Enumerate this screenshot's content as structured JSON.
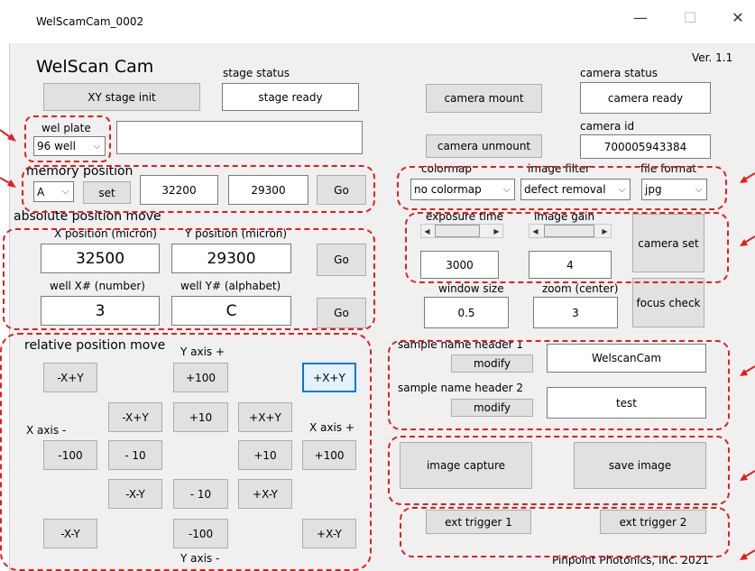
{
  "window": {
    "title": "WelScamCam_0002",
    "version": "Ver. 1.1",
    "app_name": "WelScan Cam",
    "minimize": "—",
    "maximize": "☐",
    "close": "✕",
    "footer": "Pinpoint Photonics, Inc. 2021"
  },
  "stage": {
    "status_label": "stage status",
    "status_value": "stage ready",
    "init_button": "XY stage init"
  },
  "wel_plate": {
    "label": "wel plate",
    "selected": "96 well",
    "info_value": ""
  },
  "memory_position": {
    "label": "memory position",
    "selected": "A",
    "set_button": "set",
    "x_value": "32200",
    "y_value": "29300",
    "go_button": "Go"
  },
  "absolute_move": {
    "label": "absolute position move",
    "x_label": "X position (micron)",
    "y_label": "Y position (micron)",
    "x_value": "32500",
    "y_value": "29300",
    "go_button": "Go",
    "wellx_label": "well X# (number)",
    "welly_label": "well Y# (alphabet)",
    "wellx_value": "3",
    "welly_value": "C",
    "go_button2": "Go"
  },
  "relative_move": {
    "label": "relative position move",
    "y_axis_plus": "Y axis +",
    "y_axis_minus": "Y axis -",
    "x_axis_minus": "X axis -",
    "x_axis_plus": "X axis +",
    "b_mx_py_outer": "-X+Y",
    "b_py100": "+100",
    "b_px_py_outer": "+X+Y",
    "b_mx_py_inner": "-X+Y",
    "b_py10": "+10",
    "b_px_py_inner": "+X+Y",
    "b_mx100": "-100",
    "b_mx10": "- 10",
    "b_px10": "+10",
    "b_px100": "+100",
    "b_mx_my_inner": "-X-Y",
    "b_my10": "- 10",
    "b_px_my_inner": "+X-Y",
    "b_mx_my_outer": "-X-Y",
    "b_my100": "-100",
    "b_px_my_outer": "+X-Y"
  },
  "camera": {
    "status_label": "camera status",
    "status_value": "camera ready",
    "mount_button": "camera mount",
    "unmount_button": "camera unmount",
    "id_label": "camera id",
    "id_value": "700005943384",
    "colormap_label": "colormap",
    "colormap_value": "no colormap",
    "filter_label": "image filter",
    "filter_value": "defect removal",
    "format_label": "file format",
    "format_value": "jpg",
    "exposure_label": "exposure time",
    "gain_label": "image gain",
    "exposure_value": "3000",
    "gain_value": "4",
    "camera_set_button": "camera set",
    "window_label": "window size",
    "zoom_label": "zoom (center)",
    "window_value": "0.5",
    "zoom_value": "3",
    "focus_button": "focus check"
  },
  "sample": {
    "header1_label": "sample name header 1",
    "header1_value": "WelscanCam",
    "modify1": "modify",
    "header2_label": "sample name header 2",
    "header2_value": "test",
    "modify2": "modify"
  },
  "capture": {
    "capture_button": "image capture",
    "save_button": "save image"
  },
  "trigger": {
    "ext1": "ext trigger 1",
    "ext2": "ext trigger 2"
  },
  "colors": {
    "annotation": "#e02020",
    "window_bg": "#f0f0f0",
    "button_bg": "#e1e1e1",
    "focus_border": "#0078d7"
  }
}
